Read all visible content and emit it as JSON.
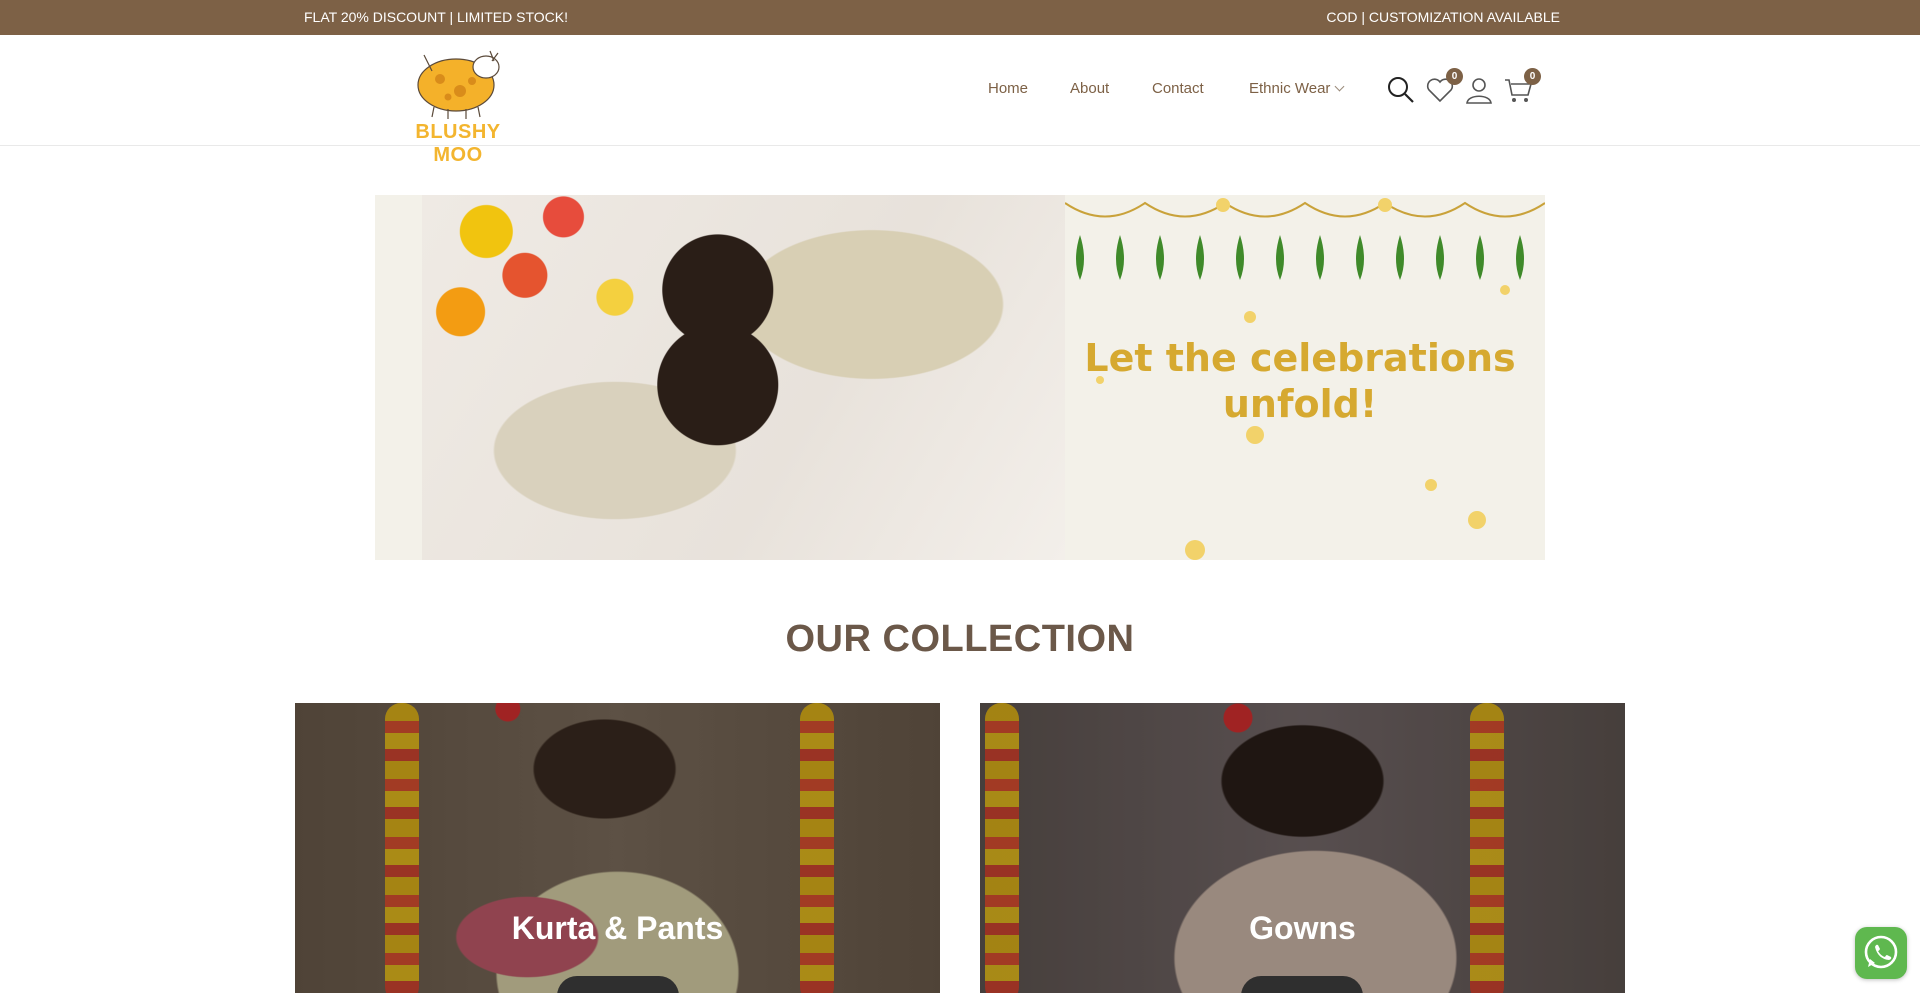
{
  "announcement": {
    "left_text": "FLAT 20% DISCOUNT | LIMITED STOCK!",
    "right_text": "COD | CUSTOMIZATION AVAILABLE",
    "bg_color": "#7d6146"
  },
  "header": {
    "logo_text": "BLUSHY MOO",
    "nav": [
      {
        "label": "Home"
      },
      {
        "label": "About"
      },
      {
        "label": "Contact"
      },
      {
        "label": "Ethnic Wear"
      }
    ],
    "icons": {
      "search": "search-icon",
      "wishlist": "heart-icon",
      "account": "user-icon",
      "cart": "cart-icon"
    },
    "wishlist_count": "0",
    "cart_count": "0"
  },
  "hero": {
    "headline": "Let the celebrations unfold!"
  },
  "collection": {
    "title": "OUR COLLECTION",
    "cards": [
      {
        "title": "Kurta & Pants"
      },
      {
        "title": "Gowns"
      }
    ]
  },
  "colors": {
    "accent": "#7d6146",
    "brand_yellow": "#f3b52f",
    "hero_text": "#d6a930"
  }
}
